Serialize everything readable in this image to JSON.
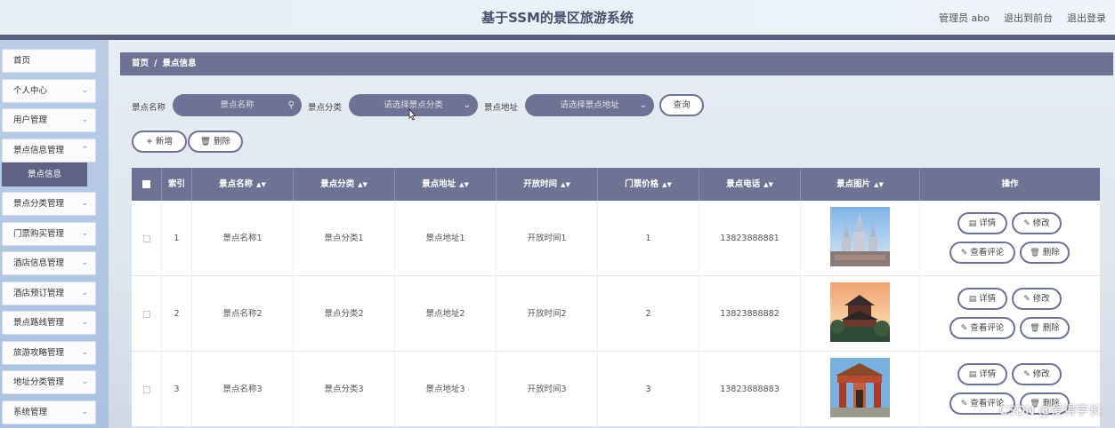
{
  "header": {
    "title": "基于SSM的景区旅游系统",
    "user": "管理员 abo",
    "to_front": "退出到前台",
    "logout": "退出登录"
  },
  "sidebar": {
    "items": [
      {
        "label": "首页",
        "has_chevron": false
      },
      {
        "label": "个人中心",
        "has_chevron": true
      },
      {
        "label": "用户管理",
        "has_chevron": true
      },
      {
        "label": "景点信息管理",
        "has_chevron": true
      },
      {
        "label": "景点分类管理",
        "has_chevron": true
      },
      {
        "label": "门票购买管理",
        "has_chevron": true
      },
      {
        "label": "酒店信息管理",
        "has_chevron": true
      },
      {
        "label": "酒店预订管理",
        "has_chevron": true
      },
      {
        "label": "景点路线管理",
        "has_chevron": true
      },
      {
        "label": "旅游攻略管理",
        "has_chevron": true
      },
      {
        "label": "地址分类管理",
        "has_chevron": true
      },
      {
        "label": "系统管理",
        "has_chevron": true
      }
    ],
    "active_sub": "景点信息"
  },
  "breadcrumb": {
    "home": "首页",
    "sep": "/",
    "current": "景点信息"
  },
  "search": {
    "name_label": "景点名称",
    "name_placeholder": "景点名称",
    "category_label": "景点分类",
    "category_placeholder": "请选择景点分类",
    "address_label": "景点地址",
    "address_placeholder": "请选择景点地址",
    "query_button": "查询"
  },
  "actions": {
    "add": "新增",
    "delete": "删除"
  },
  "table": {
    "headers": [
      "索引",
      "景点名称",
      "景点分类",
      "景点地址",
      "开放时间",
      "门票价格",
      "景点电话",
      "景点图片",
      "操作"
    ],
    "rows": [
      {
        "index": "1",
        "name": "景点名称1",
        "category": "景点分类1",
        "address": "景点地址1",
        "open_time": "开放时间1",
        "price": "1",
        "phone": "13823888881"
      },
      {
        "index": "2",
        "name": "景点名称2",
        "category": "景点分类2",
        "address": "景点地址2",
        "open_time": "开放时间2",
        "price": "2",
        "phone": "13823888882"
      },
      {
        "index": "3",
        "name": "景点名称3",
        "category": "景点分类3",
        "address": "景点地址3",
        "open_time": "开放时间3",
        "price": "3",
        "phone": "13823888883"
      }
    ],
    "row_actions": {
      "detail": "详情",
      "edit": "修改",
      "comments": "查看评论",
      "delete": "删除"
    }
  },
  "watermark": "CSDN @爱得学长",
  "colors": {
    "primary": "#6f7393",
    "header_bar": "#5d607f",
    "sidebar": "#b9cde6"
  }
}
